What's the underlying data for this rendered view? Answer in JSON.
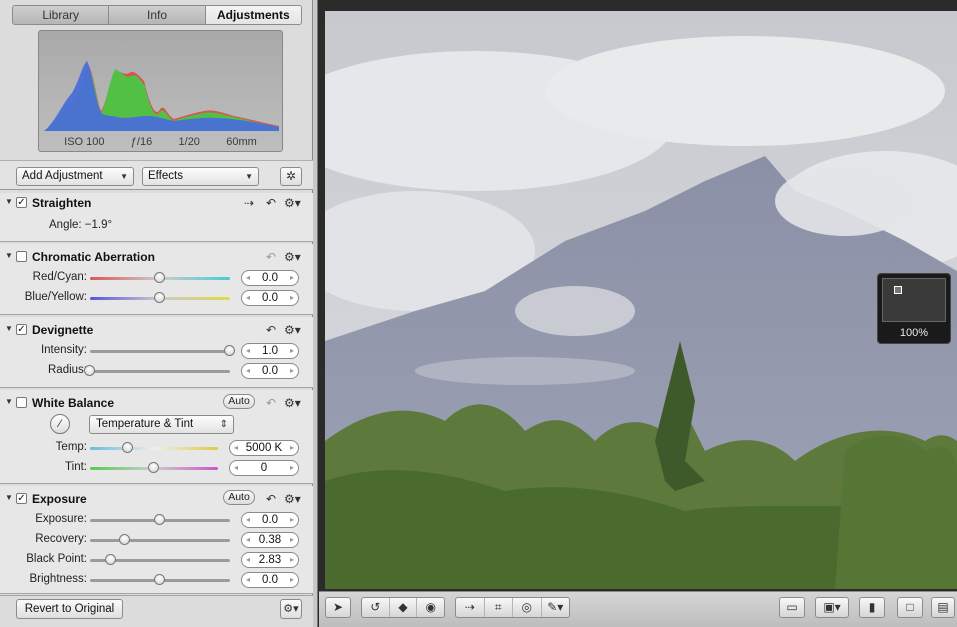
{
  "tabs": [
    {
      "label": "Library"
    },
    {
      "label": "Info"
    },
    {
      "label": "Adjustments"
    }
  ],
  "histogram": {
    "iso": "ISO 100",
    "aperture": "ƒ/16",
    "shutter": "1/20",
    "focal": "60mm"
  },
  "controls": {
    "add_adjustment": "Add Adjustment",
    "effects": "Effects"
  },
  "straighten": {
    "title": "Straighten",
    "checked": true,
    "angle_label": "Angle: −1.9°"
  },
  "chromatic": {
    "title": "Chromatic Aberration",
    "checked": false,
    "red_cyan": {
      "label": "Red/Cyan:",
      "value": "0.0",
      "level": 0.5
    },
    "blue_yellow": {
      "label": "Blue/Yellow:",
      "value": "0.0",
      "level": 0.5
    }
  },
  "devignette": {
    "title": "Devignette",
    "checked": true,
    "intensity": {
      "label": "Intensity:",
      "value": "1.0",
      "level": 1.0
    },
    "radius": {
      "label": "Radius:",
      "value": "0.0",
      "level": 0.0
    }
  },
  "white_balance": {
    "title": "White Balance",
    "checked": false,
    "auto": "Auto",
    "mode": "Temperature & Tint",
    "temp": {
      "label": "Temp:",
      "value": "5000 K",
      "level": 0.3
    },
    "tint": {
      "label": "Tint:",
      "value": "0",
      "level": 0.5
    }
  },
  "exposure": {
    "title": "Exposure",
    "checked": true,
    "auto": "Auto",
    "exposure": {
      "label": "Exposure:",
      "value": "0.0",
      "level": 0.5
    },
    "recovery": {
      "label": "Recovery:",
      "value": "0.38",
      "level": 0.25
    },
    "black_point": {
      "label": "Black Point:",
      "value": "2.83",
      "level": 0.15
    },
    "brightness": {
      "label": "Brightness:",
      "value": "0.0",
      "level": 0.5
    }
  },
  "bottom": {
    "revert": "Revert to Original"
  },
  "viewer": {
    "zoom": "100%"
  },
  "icons": [
    "disclosure-triangle-icon",
    "checkbox-icon",
    "straighten-icon",
    "reset-icon",
    "gear-icon",
    "eyedropper-icon",
    "magic-wand-icon",
    "arrow-tool-icon",
    "rotate-icon",
    "lift-icon",
    "stamp-icon",
    "straighten-tool-icon",
    "crop-icon",
    "red-eye-icon",
    "brush-icon",
    "viewer-mode-icon",
    "compare-icon",
    "filmstrip-icon",
    "single-view-icon",
    "multi-view-icon"
  ]
}
